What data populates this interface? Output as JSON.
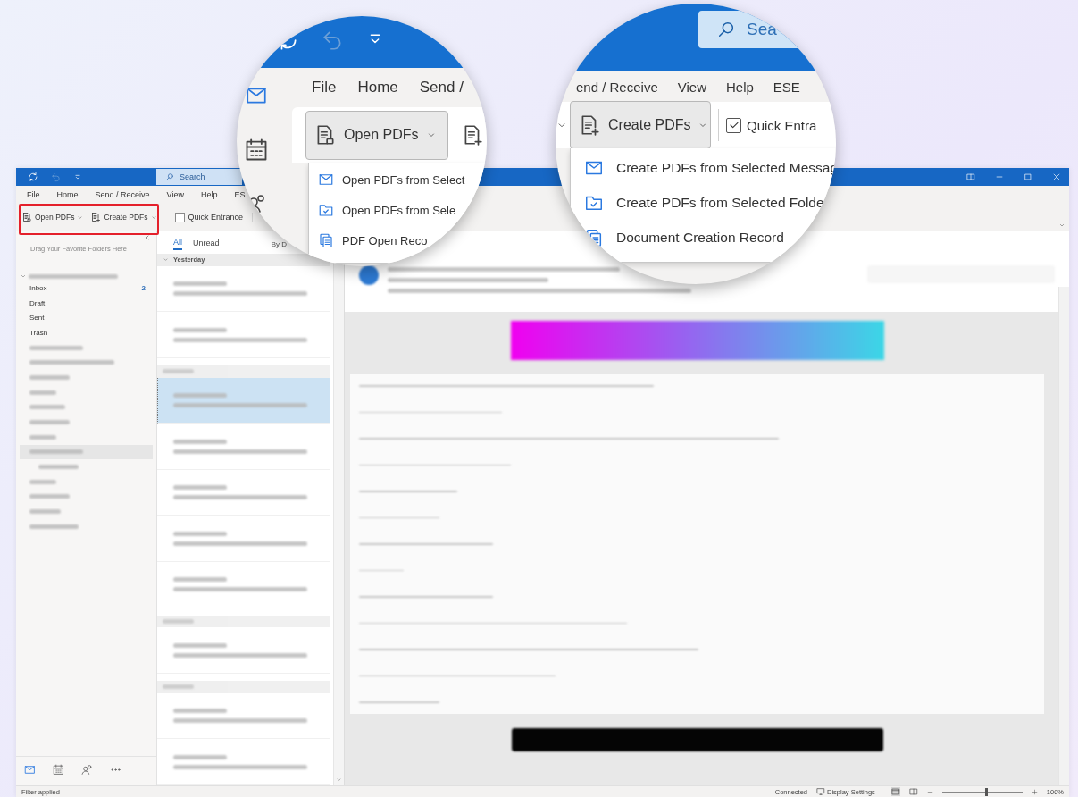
{
  "title_bar": {
    "search": {
      "placeholder": "Search"
    }
  },
  "ribbon_tabs": [
    {
      "label": "File"
    },
    {
      "label": "Home"
    },
    {
      "label": "Send / Receive"
    },
    {
      "label": "View"
    },
    {
      "label": "Help"
    },
    {
      "label": "ES"
    }
  ],
  "ribbon": {
    "buttons": [
      {
        "label": "Open PDFs",
        "kind": "open"
      },
      {
        "label": "Create PDFs",
        "kind": "create"
      }
    ],
    "checkbox": {
      "label": "Quick Entrance",
      "checked": false
    }
  },
  "folder_pane": {
    "favorites_hint": "Drag Your Favorite Folders Here",
    "folders": [
      {
        "name": "Inbox",
        "count": "2"
      },
      {
        "name": "Draft"
      },
      {
        "name": "Sent"
      },
      {
        "name": "Trash"
      }
    ]
  },
  "message_list": {
    "filters": [
      {
        "label": "All",
        "selected": true
      },
      {
        "label": "Unread",
        "selected": false
      }
    ],
    "sort_label": "By D",
    "groups": [
      {
        "label": "Yesterday"
      }
    ]
  },
  "status_bar": {
    "message": "Filter applied",
    "connection": "Connected",
    "display_settings": "Display Settings",
    "zoom_slider": {
      "level": 0.55
    },
    "zoom": "100%"
  },
  "magnifiers": [
    {
      "tabs": [
        {
          "label": "File"
        },
        {
          "label": "Home"
        },
        {
          "label": "Send /"
        }
      ],
      "button": {
        "label": "Open PDFs",
        "kind": "open"
      },
      "menu": [
        {
          "label": "Open PDFs from Select",
          "kind": "message"
        },
        {
          "label": "Open PDFs from Sele",
          "kind": "folder"
        },
        {
          "label": "PDF Open Reco",
          "kind": "record"
        }
      ]
    },
    {
      "search": {
        "placeholder": "Sea"
      },
      "tabs": [
        {
          "label": "end / Receive"
        },
        {
          "label": "View"
        },
        {
          "label": "Help"
        },
        {
          "label": "ESE"
        }
      ],
      "button": {
        "label": "Create PDFs",
        "kind": "create"
      },
      "checkbox": {
        "label": "Quick Entra",
        "checked": true
      },
      "menu": [
        {
          "label": "Create PDFs from Selected Messag",
          "kind": "message"
        },
        {
          "label": "Create PDFs from Selected Folde",
          "kind": "folder"
        },
        {
          "label": "Document Creation Record",
          "kind": "record"
        }
      ]
    }
  ]
}
